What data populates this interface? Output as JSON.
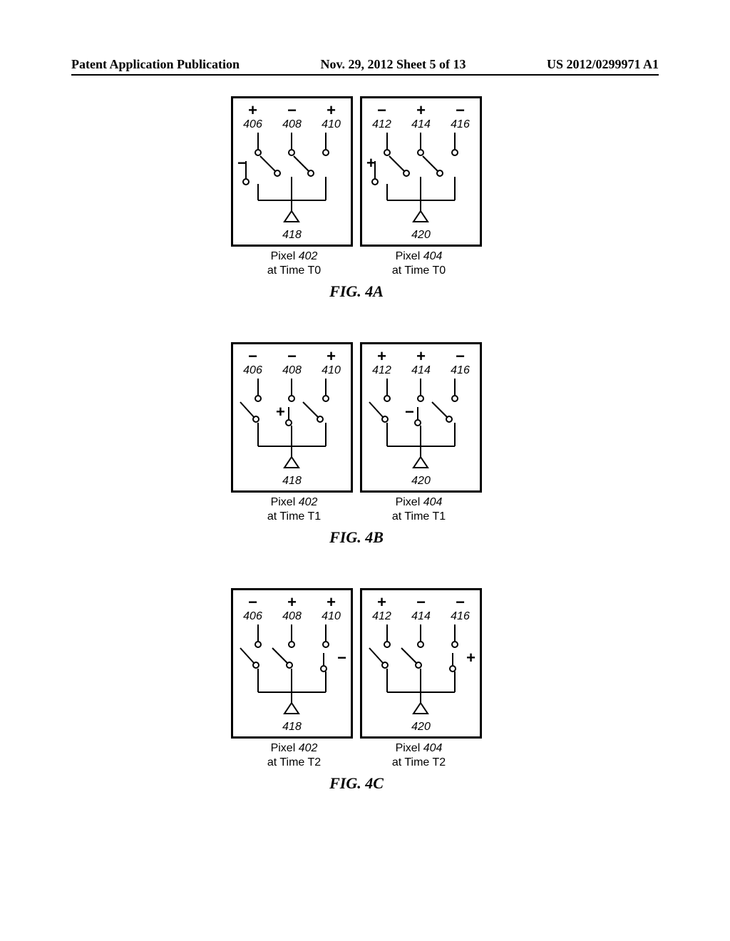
{
  "header": {
    "left": "Patent Application Publication",
    "mid": "Nov. 29, 2012  Sheet 5 of 13",
    "right": "US 2012/0299971 A1"
  },
  "figures": [
    {
      "title": "FIG. 4A",
      "panels": [
        {
          "signs": [
            "+",
            "−",
            "+"
          ],
          "nums": [
            "406",
            "408",
            "410"
          ],
          "side_sign": "−",
          "side_pos": "left",
          "bottom": "418",
          "caption_label": "Pixel",
          "caption_num": "402",
          "caption_time": "at Time T0"
        },
        {
          "signs": [
            "−",
            "+",
            "−"
          ],
          "nums": [
            "412",
            "414",
            "416"
          ],
          "side_sign": "+",
          "side_pos": "left",
          "bottom": "420",
          "caption_label": "Pixel",
          "caption_num": "404",
          "caption_time": "at Time T0"
        }
      ]
    },
    {
      "title": "FIG. 4B",
      "panels": [
        {
          "signs": [
            "−",
            "−",
            "+"
          ],
          "nums": [
            "406",
            "408",
            "410"
          ],
          "side_sign": "+",
          "side_pos": "mid",
          "bottom": "418",
          "caption_label": "Pixel",
          "caption_num": "402",
          "caption_time": "at Time T1"
        },
        {
          "signs": [
            "+",
            "+",
            "−"
          ],
          "nums": [
            "412",
            "414",
            "416"
          ],
          "side_sign": "−",
          "side_pos": "mid",
          "bottom": "420",
          "caption_label": "Pixel",
          "caption_num": "404",
          "caption_time": "at Time T1"
        }
      ]
    },
    {
      "title": "FIG. 4C",
      "panels": [
        {
          "signs": [
            "−",
            "+",
            "+"
          ],
          "nums": [
            "406",
            "408",
            "410"
          ],
          "side_sign": "−",
          "side_pos": "right",
          "bottom": "418",
          "caption_label": "Pixel",
          "caption_num": "402",
          "caption_time": "at Time T2"
        },
        {
          "signs": [
            "+",
            "−",
            "−"
          ],
          "nums": [
            "412",
            "414",
            "416"
          ],
          "side_sign": "+",
          "side_pos": "right",
          "bottom": "420",
          "caption_label": "Pixel",
          "caption_num": "404",
          "caption_time": "at Time T2"
        }
      ]
    }
  ]
}
